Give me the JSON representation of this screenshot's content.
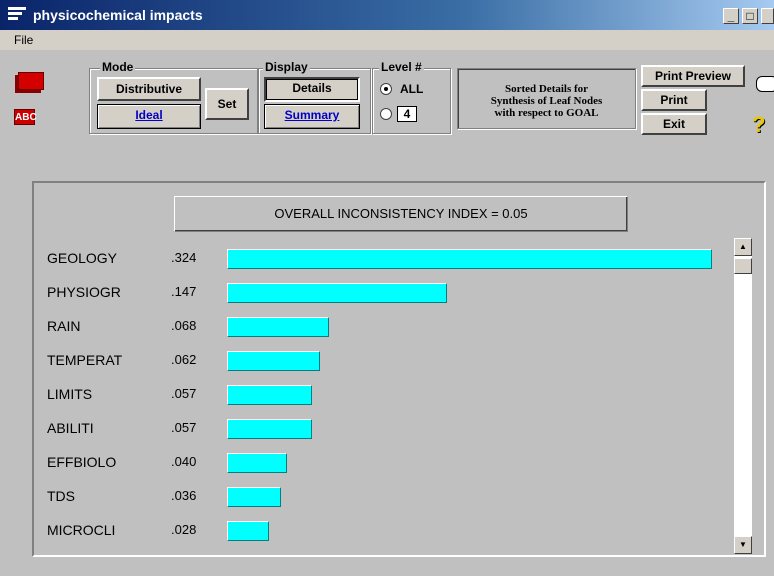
{
  "window": {
    "title": "physicochemical impacts",
    "minimize": "_",
    "maximize": "□"
  },
  "menu": {
    "file": "File"
  },
  "mode": {
    "label": "Mode",
    "distributive": "Distributive",
    "ideal": "Ideal",
    "set": "Set"
  },
  "display": {
    "label": "Display",
    "details": "Details",
    "summary": "Summary"
  },
  "level": {
    "label": "Level #",
    "all": "ALL",
    "value": "4",
    "selected": "ALL"
  },
  "sorted_box": {
    "line1": "Sorted Details for",
    "line2": "Synthesis of Leaf Nodes",
    "line3": "with respect to GOAL"
  },
  "actions": {
    "print_preview": "Print Preview",
    "print": "Print",
    "exit": "Exit"
  },
  "icons": {
    "abc": "ABC",
    "help": "?"
  },
  "inconsistency": "OVERALL INCONSISTENCY INDEX =  0.05",
  "chart_data": {
    "type": "bar",
    "categories": [
      "GEOLOGY",
      "PHYSIOGR",
      "RAIN",
      "TEMPERAT",
      "LIMITS",
      "ABILITI",
      "EFFBIOLO",
      "TDS",
      "MICROCLI"
    ],
    "labels": [
      ".324",
      ".147",
      ".068",
      ".062",
      ".057",
      ".057",
      ".040",
      ".036",
      ".028"
    ],
    "values": [
      0.324,
      0.147,
      0.068,
      0.062,
      0.057,
      0.057,
      0.04,
      0.036,
      0.028
    ],
    "colors": {
      "bar": "#00ffff"
    }
  }
}
